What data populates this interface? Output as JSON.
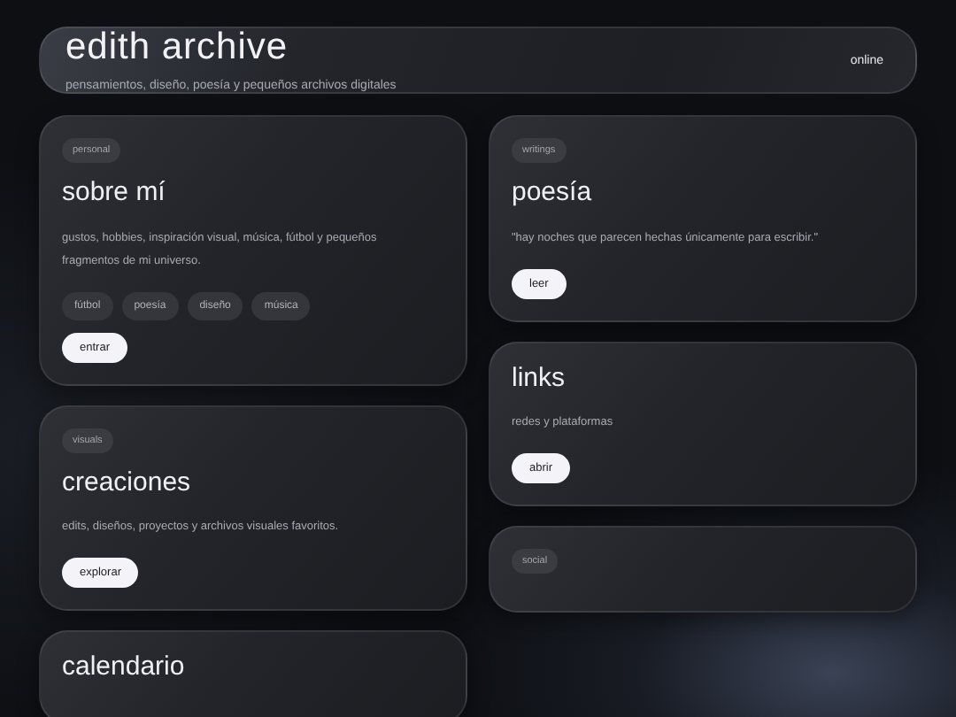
{
  "header": {
    "title": "edith archive",
    "subtitle": "pensamientos, diseño, poesía y pequeños archivos digitales",
    "status": "online"
  },
  "columns": [
    {
      "cards": [
        {
          "tag": "personal",
          "title": "sobre mí",
          "text": "gustos, hobbies, inspiración visual, música, fútbol y pequeños fragmentos de mi universo.",
          "chips": [
            "fútbol",
            "poesía",
            "diseño",
            "música"
          ],
          "button": "entrar"
        },
        {
          "tag": "visuals",
          "title": "creaciones",
          "text": "edits, diseños, proyectos y archivos visuales favoritos.",
          "button": "explorar"
        },
        {
          "title": "calendario"
        }
      ]
    },
    {
      "cards": [
        {
          "tag": "writings",
          "title": "poesía",
          "text": "\"hay noches que parecen hechas únicamente para escribir.\"",
          "button": "leer"
        },
        {
          "title": "links",
          "text": "redes y plataformas",
          "button": "abrir"
        },
        {
          "tag": "social"
        }
      ]
    }
  ]
}
